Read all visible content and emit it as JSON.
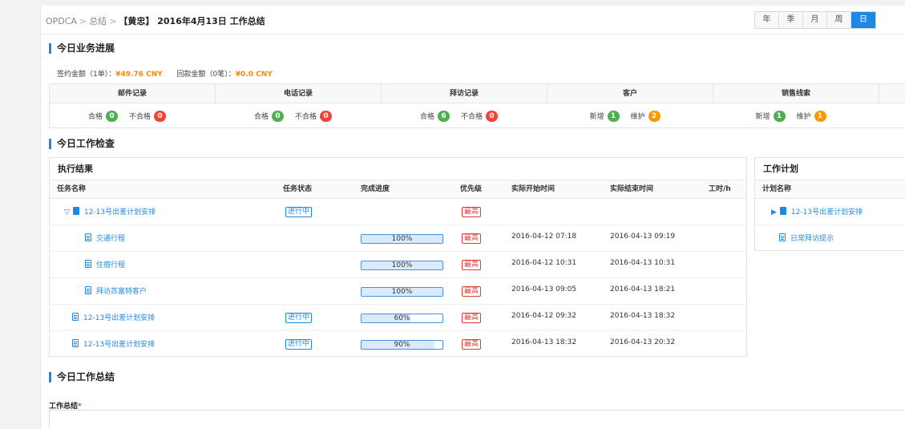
{
  "breadcrumb": {
    "root": "OPDCA",
    "sep": ">",
    "level1": "总结",
    "current": "【黄忠】 2016年4月13日 工作总结"
  },
  "period_tabs": [
    {
      "label": "年",
      "active": false
    },
    {
      "label": "季",
      "active": false
    },
    {
      "label": "月",
      "active": false
    },
    {
      "label": "周",
      "active": false
    },
    {
      "label": "日",
      "active": true
    }
  ],
  "sections": {
    "business": "今日业务进展",
    "check": "今日工作检查",
    "summary": "今日工作总结"
  },
  "amounts": {
    "sign_label": "签约金额（1单）：",
    "sign_value": "¥49.76 CNY",
    "payback_label": "回款金额（0笔）：",
    "payback_value": "¥0.0 CNY"
  },
  "business_stats": [
    {
      "header": "邮件记录",
      "a_label": "合格",
      "a_value": "0",
      "a_color": "green",
      "b_label": "不合格",
      "b_value": "0",
      "b_color": "red"
    },
    {
      "header": "电话记录",
      "a_label": "合格",
      "a_value": "0",
      "a_color": "green",
      "b_label": "不合格",
      "b_value": "0",
      "b_color": "red"
    },
    {
      "header": "拜访记录",
      "a_label": "合格",
      "a_value": "6",
      "a_color": "green",
      "b_label": "不合格",
      "b_value": "0",
      "b_color": "red"
    },
    {
      "header": "客户",
      "a_label": "新增",
      "a_value": "1",
      "a_color": "green",
      "b_label": "维护",
      "b_value": "2",
      "b_color": "orange"
    },
    {
      "header": "销售线索",
      "a_label": "新增",
      "a_value": "1",
      "a_color": "green",
      "b_label": "维护",
      "b_value": "1",
      "b_color": "orange"
    }
  ],
  "exec": {
    "title": "执行结果",
    "columns": [
      "任务名称",
      "任务状态",
      "完成进度",
      "优先级",
      "实际开始时间",
      "实际结束时间",
      "工时/h"
    ],
    "rows": [
      {
        "name": "12-13号出差计划安排",
        "level": 0,
        "expand": "▽",
        "status": "进行中",
        "progress": null,
        "progress_text": "",
        "priority": "最高",
        "start": "",
        "end": ""
      },
      {
        "name": "交通行程",
        "level": 1,
        "expand": "",
        "status": "",
        "progress": 1.0,
        "progress_text": "100%",
        "priority": "最高",
        "start": "2016-04-12 07:18",
        "end": "2016-04-13 09:19"
      },
      {
        "name": "住宿行程",
        "level": 1,
        "expand": "",
        "status": "",
        "progress": 1.0,
        "progress_text": "100%",
        "priority": "最高",
        "start": "2016-04-12 10:31",
        "end": "2016-04-13 10:31"
      },
      {
        "name": "拜访苏富特客户",
        "level": 1,
        "expand": "",
        "status": "",
        "progress": 1.0,
        "progress_text": "100%",
        "priority": "最高",
        "start": "2016-04-13 09:05",
        "end": "2016-04-13 18:21"
      },
      {
        "name": "12-13号出差计划安排",
        "level": 0.5,
        "expand": "",
        "status": "进行中",
        "progress": 0.6,
        "progress_text": "60%",
        "priority": "最高",
        "start": "2016-04-12 09:32",
        "end": "2016-04-13 18:32"
      },
      {
        "name": "12-13号出差计划安排",
        "level": 0.5,
        "expand": "",
        "status": "进行中",
        "progress": 0.9,
        "progress_text": "90%",
        "priority": "最高",
        "start": "2016-04-13 18:32",
        "end": "2016-04-13 20:32"
      }
    ]
  },
  "plan": {
    "title": "工作计划",
    "column": "计划名称",
    "items": [
      {
        "name": "12-13号出差计划安排",
        "expand": "▶"
      },
      {
        "name": "日常拜访提示",
        "expand": ""
      }
    ]
  },
  "summary": {
    "label": "工作总结",
    "required_mark": "*",
    "value": ""
  }
}
